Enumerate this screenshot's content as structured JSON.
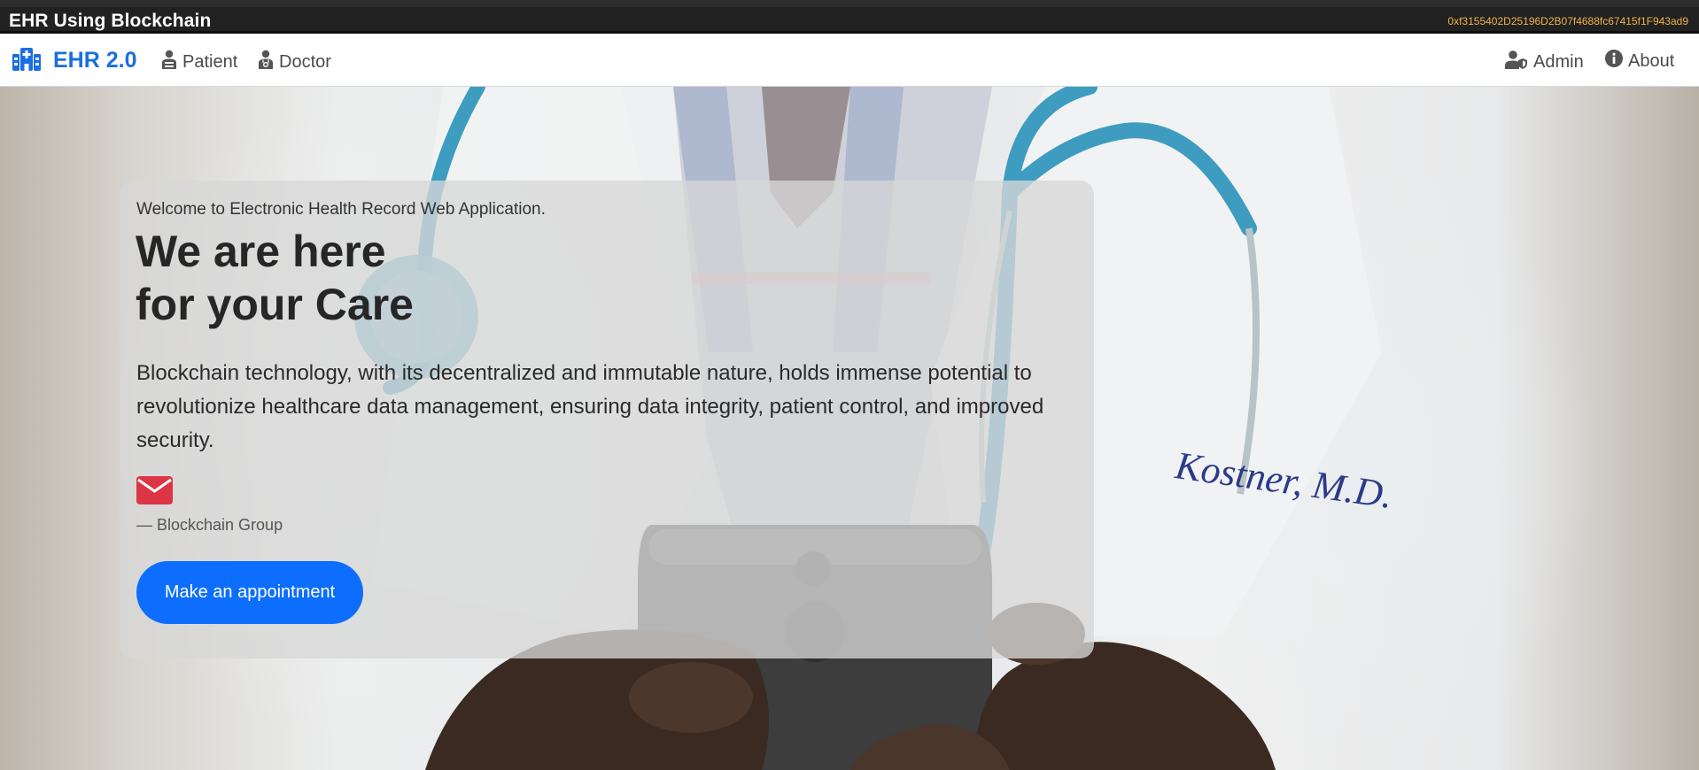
{
  "topbar": {
    "title": "EHR Using Blockchain",
    "wallet_address": "0xf3155402D25196D2B07f4688fc67415f1F943ad9"
  },
  "navbar": {
    "brand": "EHR 2.0",
    "brand_icon": "hospital-icon",
    "left_links": [
      {
        "label": "Patient",
        "icon": "patient-icon"
      },
      {
        "label": "Doctor",
        "icon": "doctor-icon"
      }
    ],
    "right_links": [
      {
        "label": "Admin",
        "icon": "admin-icon"
      },
      {
        "label": "About",
        "icon": "info-icon"
      }
    ]
  },
  "hero": {
    "welcome": "Welcome to Electronic Health Record Web Application.",
    "headline_line1": "We are here",
    "headline_line2": "for your Care",
    "description": "Blockchain technology, with its decentralized and immutable nature, holds immense potential to revolutionize healthcare data management, ensuring data integrity, patient control, and improved security.",
    "attribution": "— Blockchain Group",
    "cta_label": "Make an appointment"
  },
  "colors": {
    "brand": "#1a6fe0",
    "cta": "#0d6efd",
    "mail_icon": "#dc3545",
    "wallet": "#f0b44c",
    "topbar": "#212121"
  }
}
